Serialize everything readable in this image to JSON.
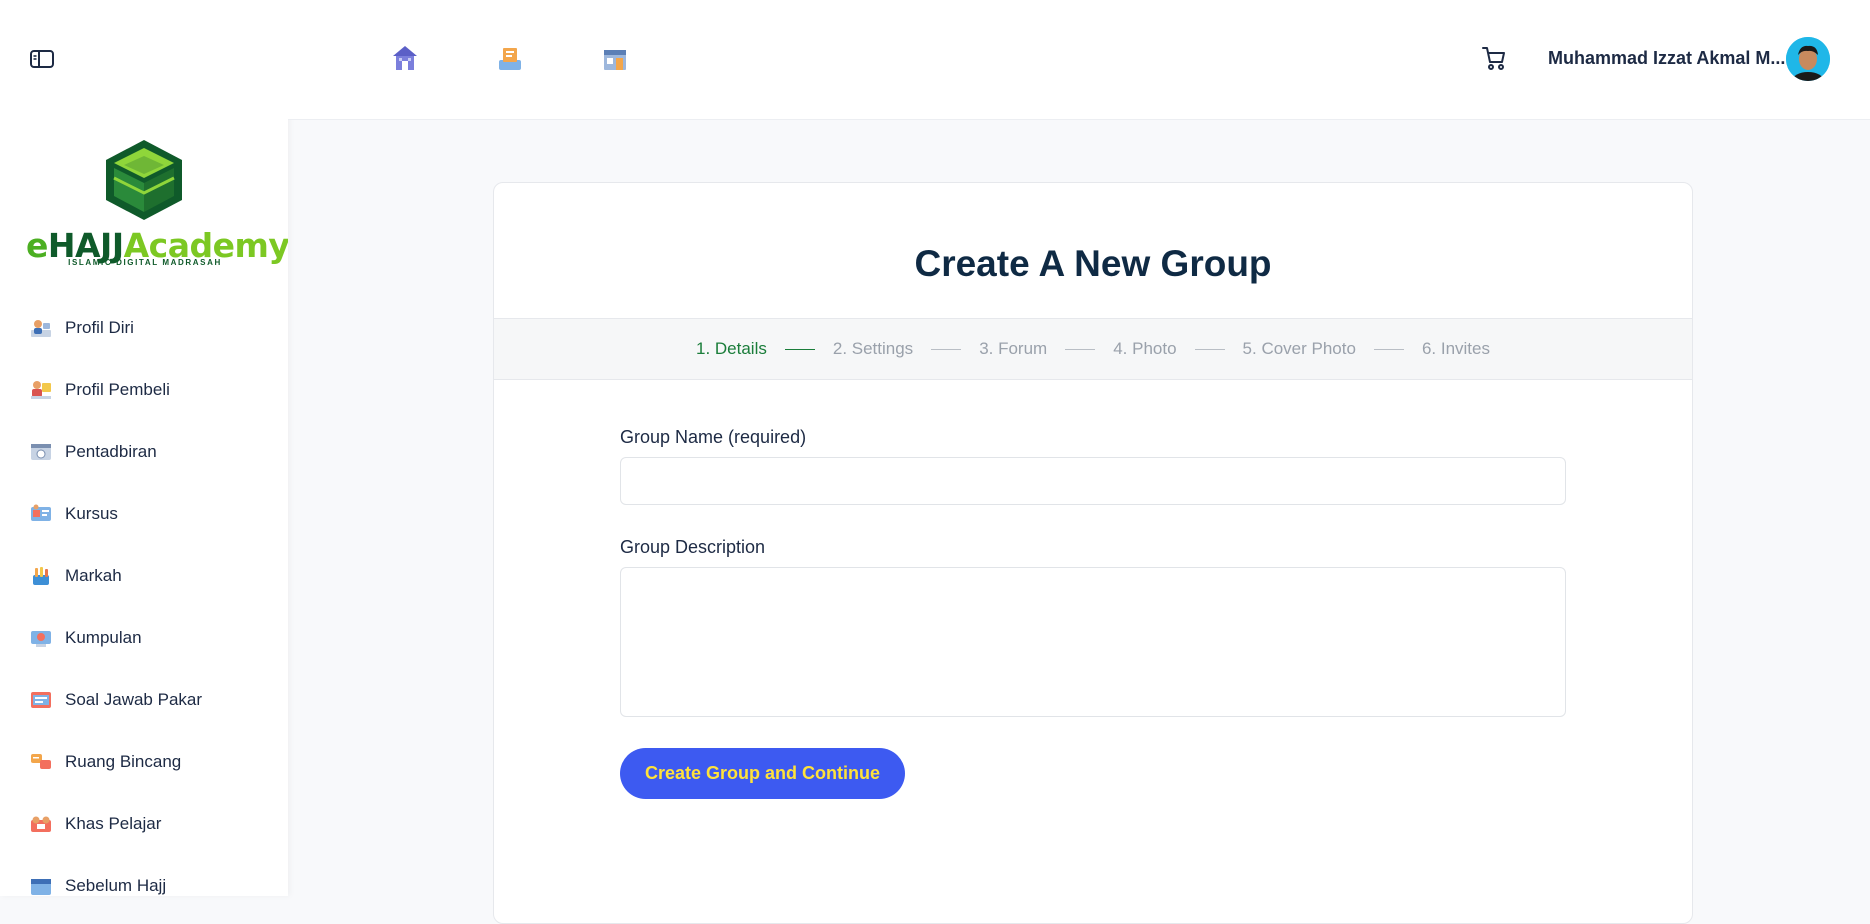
{
  "brand": {
    "e": "e",
    "hajj": "HAJJ",
    "academy": "Academy",
    "tagline": "ISLAMIC DIGITAL MADRASAH",
    "colors": {
      "green_dark": "#0f5a2a",
      "green_light": "#7cc823"
    }
  },
  "sidebar": {
    "toggle_icon": "sidebar-toggle-icon",
    "items": [
      {
        "label": "Profil Diri",
        "icon": "profile-icon"
      },
      {
        "label": "Profil Pembeli",
        "icon": "buyer-profile-icon"
      },
      {
        "label": "Pentadbiran",
        "icon": "administration-icon"
      },
      {
        "label": "Kursus",
        "icon": "courses-icon"
      },
      {
        "label": "Markah",
        "icon": "marks-icon"
      },
      {
        "label": "Kumpulan",
        "icon": "groups-icon"
      },
      {
        "label": "Soal Jawab Pakar",
        "icon": "expert-qa-icon"
      },
      {
        "label": "Ruang Bincang",
        "icon": "discussion-icon"
      },
      {
        "label": "Khas Pelajar",
        "icon": "student-icon"
      },
      {
        "label": "Sebelum Hajj",
        "icon": "calendar-icon"
      }
    ]
  },
  "topbar": {
    "icons": [
      "home-icon",
      "library-icon",
      "store-icon"
    ],
    "cart_icon": "cart-icon",
    "user_name": "Muhammad Izzat Akmal M...",
    "avatar_color": "#1fb7e8"
  },
  "page": {
    "title": "Create A New Group",
    "steps": [
      {
        "label": "1. Details",
        "active": true
      },
      {
        "label": "2. Settings",
        "active": false
      },
      {
        "label": "3. Forum",
        "active": false
      },
      {
        "label": "4. Photo",
        "active": false
      },
      {
        "label": "5. Cover Photo",
        "active": false
      },
      {
        "label": "6. Invites",
        "active": false
      }
    ],
    "group_name_label": "Group Name (required)",
    "group_name_value": "",
    "group_description_label": "Group Description",
    "group_description_value": "",
    "submit_label": "Create Group and Continue",
    "accent_color": "#3d5af1",
    "active_step_color": "#1a7d3a"
  }
}
